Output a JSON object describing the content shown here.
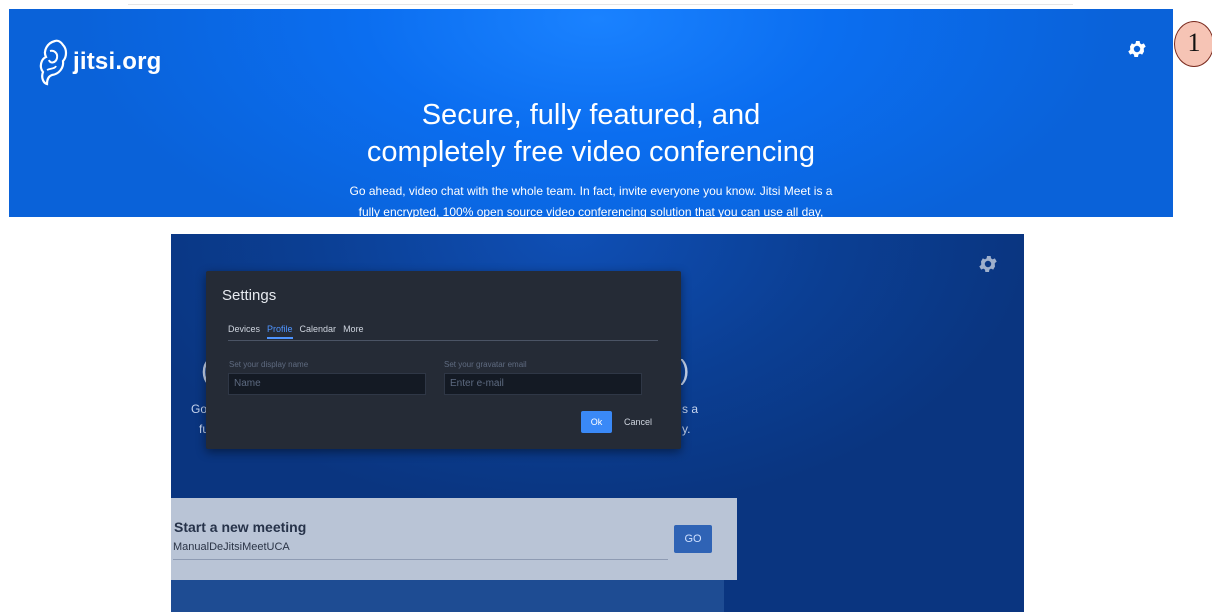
{
  "callout_number": "1",
  "top": {
    "logo_text": "jitsi.org",
    "headline_line1": "Secure, fully featured, and",
    "headline_line2": "completely free video conferencing",
    "desc_line1": "Go ahead, video chat with the whole team. In fact, invite everyone you know. Jitsi Meet is a",
    "desc_line2": "fully encrypted, 100% open source video conferencing solution that you can use all day,"
  },
  "bottom": {
    "settings": {
      "title": "Settings",
      "tabs": [
        "Devices",
        "Profile",
        "Calendar",
        "More"
      ],
      "active_tab": "Profile",
      "display_name_label": "Set your display name",
      "display_name_placeholder": "Name",
      "email_label": "Set your gravatar email",
      "email_placeholder": "Enter e-mail",
      "ok_label": "Ok",
      "cancel_label": "Cancel"
    },
    "bg_fragments": {
      "left_go": "Go",
      "left_fu": "fu",
      "right_sa": "s a",
      "right_y": "y."
    },
    "meeting": {
      "title": "Start a new meeting",
      "room_value": "ManualDeJitsiMeetUCA",
      "go_label": "GO"
    }
  },
  "colors": {
    "brand_blue": "#0b6ef0",
    "dialog_bg": "#252b36",
    "accent": "#3a89f7"
  }
}
